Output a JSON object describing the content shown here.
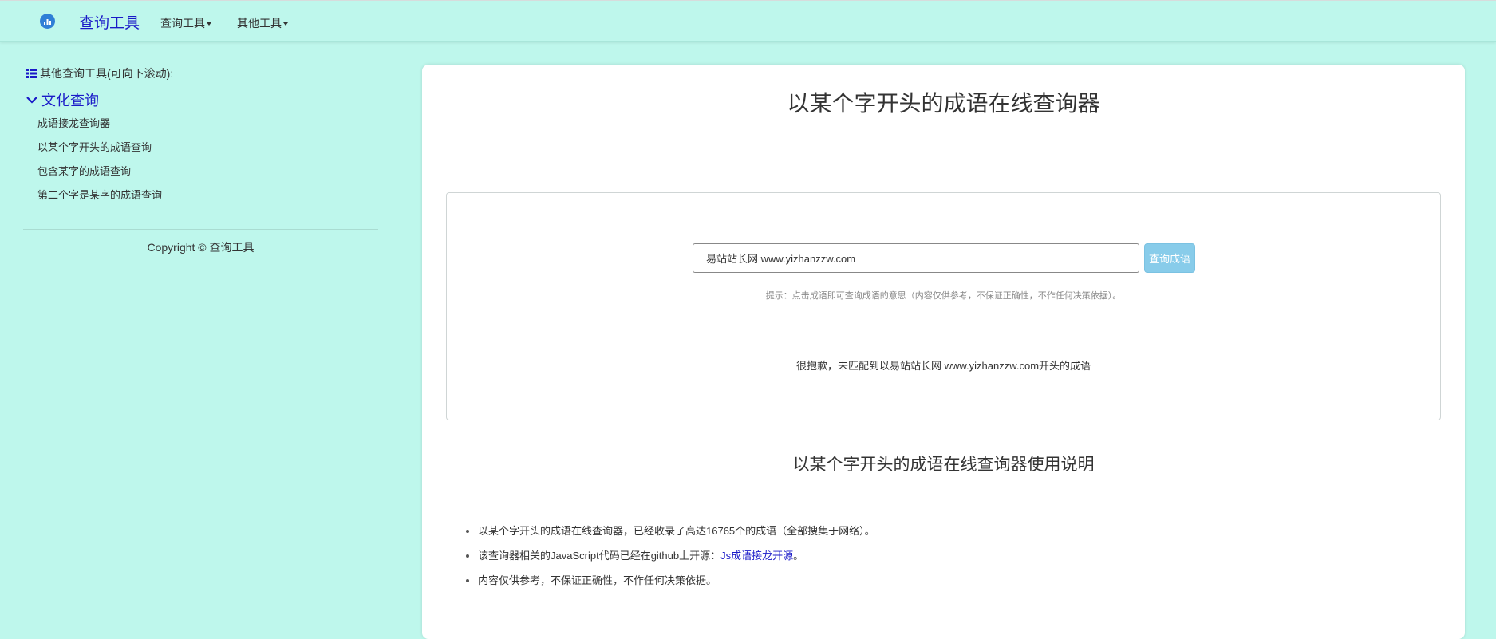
{
  "navbar": {
    "brand": "查询工具",
    "menus": [
      {
        "label": "查询工具"
      },
      {
        "label": "其他工具"
      }
    ]
  },
  "sidebar": {
    "header": "其他查询工具(可向下滚动):",
    "category": "文化查询",
    "items": [
      {
        "label": "成语接龙查询器"
      },
      {
        "label": "以某个字开头的成语查询"
      },
      {
        "label": "包含某字的成语查询"
      },
      {
        "label": "第二个字是某字的成语查询"
      }
    ],
    "copyright": "Copyright © 查询工具"
  },
  "main": {
    "title": "以某个字开头的成语在线查询器",
    "search": {
      "value": "易站站长网 www.yizhanzzw.com",
      "button_label": "查询成语"
    },
    "hint": "提示：点击成语即可查询成语的意思（内容仅供参考，不保证正确性，不作任何决策依据）。",
    "result": "很抱歉，未匹配到以易站站长网 www.yizhanzzw.com开头的成语",
    "usage": {
      "title": "以某个字开头的成语在线查询器使用说明",
      "item1": "以某个字开头的成语在线查询器，已经收录了高达16765个的成语（全部搜集于网络）。",
      "item2_prefix": "该查询器相关的JavaScript代码已经在github上开源：",
      "item2_link": "Js成语接龙开源",
      "item2_suffix": "。",
      "item3": "内容仅供参考，不保证正确性，不作任何决策依据。"
    }
  },
  "colors": {
    "background": "#bef7ec",
    "link": "#1a1ac8",
    "button": "#88ccea"
  }
}
